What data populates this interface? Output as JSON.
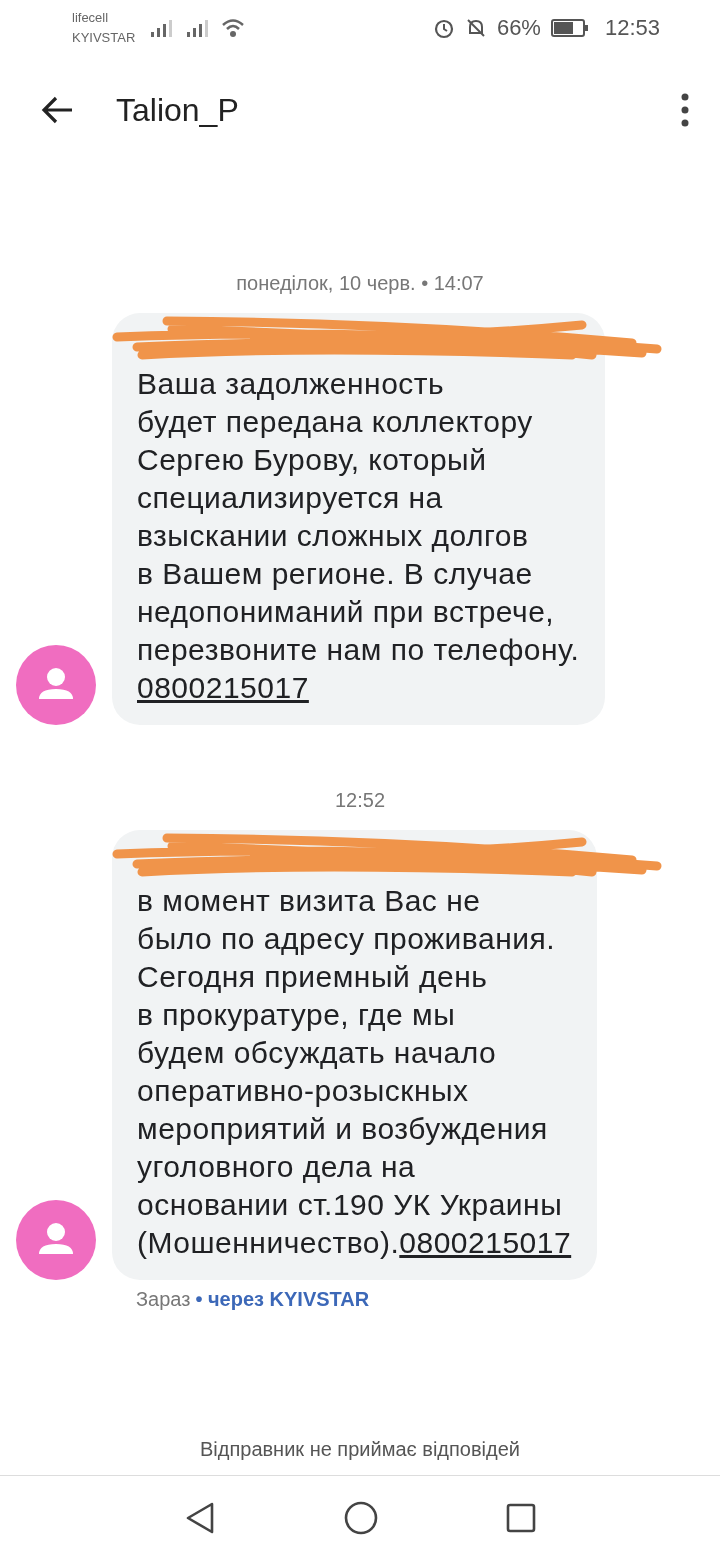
{
  "status_bar": {
    "carriers": [
      "lifecell",
      "KYIVSTAR"
    ],
    "battery": "66%",
    "time": "12:53"
  },
  "header": {
    "title": "Talion_P"
  },
  "messages": [
    {
      "timestamp": "понеділок, 10 черв. • 14:07",
      "redacted": true,
      "text": "Ваша задолженность\nбудет передана коллектору\nСергею Бурову, который\nспециализируется на\nвзыскании сложных долгов\nв Вашем регионе. В случае\nнедопониманий при встрече,\nперезвоните нам по телефону.",
      "phone": "0800215017",
      "phone_inline": false
    },
    {
      "timestamp": "12:52",
      "redacted": true,
      "text": "в момент визита Вас не\nбыло по адресу проживания.\nСегодня приемный день\nв прокуратуре, где мы\nбудем обсуждать начало\nоперативно-розыскных\nмероприятий и возбуждения\nуголовного дела на\nосновании ст.190 УК Украины\n(Мошенничество).",
      "phone": "0800215017",
      "phone_inline": true
    }
  ],
  "delivery": {
    "time": "Зараз",
    "via": "• через KYIVSTAR"
  },
  "notice": "Відправник не приймає відповідей"
}
